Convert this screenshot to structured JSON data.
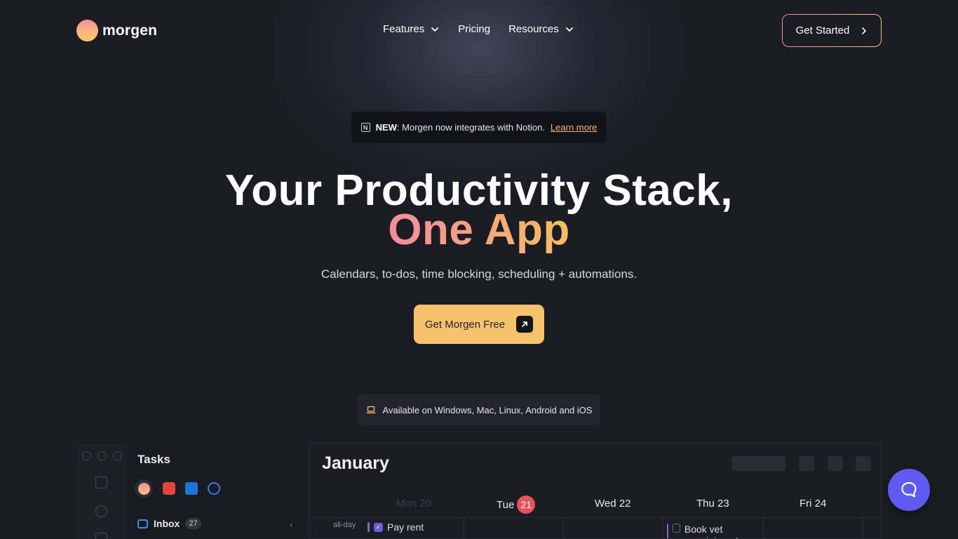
{
  "brand": {
    "name": "morgen"
  },
  "nav": {
    "links": [
      {
        "label": "Features",
        "has_dropdown": true
      },
      {
        "label": "Pricing",
        "has_dropdown": false
      },
      {
        "label": "Resources",
        "has_dropdown": true
      }
    ],
    "cta_label": "Get Started"
  },
  "banner": {
    "icon": "notion-icon",
    "new_label": "NEW",
    "text": ": Morgen now integrates with Notion.",
    "link_label": "Learn more"
  },
  "hero": {
    "title_line1": "Your Productivity Stack,",
    "title_line2": "One App",
    "subtitle": "Calendars, to-dos, time blocking, scheduling + automations.",
    "cta_label": "Get Morgen Free"
  },
  "platforms": {
    "icon": "laptop-icon",
    "text": "Available on Windows, Mac, Linux, Android and iOS"
  },
  "app_preview": {
    "tasks": {
      "title": "Tasks",
      "sources": [
        "morgen-icon",
        "todoist-icon",
        "outlook-icon",
        "check-circle-icon"
      ],
      "inbox_label": "Inbox",
      "inbox_count": "27"
    },
    "calendar": {
      "month": "January",
      "days": [
        {
          "label": "Mon 20",
          "dim": true
        },
        {
          "label": "Tue",
          "badge": "21"
        },
        {
          "label": "Wed 22"
        },
        {
          "label": "Thu 23"
        },
        {
          "label": "Fri 24"
        }
      ],
      "allday_label": "all-day",
      "events": [
        {
          "label": "Pay rent",
          "done": true
        },
        {
          "label": "Book vet appointment",
          "done": false
        }
      ]
    }
  },
  "colors": {
    "background": "#1b1c24",
    "accent_yellow": "#f6c26b",
    "accent_pink": "#f58a9e",
    "support": "#5f5bf0",
    "today": "#e8525a"
  }
}
